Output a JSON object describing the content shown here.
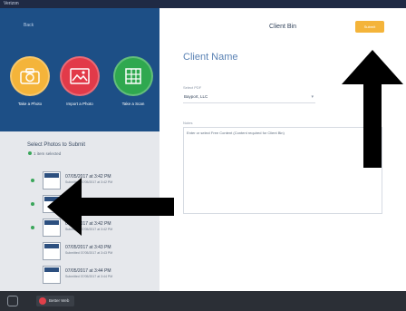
{
  "status_bar": {
    "left": "Verizon",
    "center": "",
    "right": ""
  },
  "sidebar": {
    "back_label": "Back",
    "actions": [
      {
        "label": "Take a Photo",
        "color": "#f4b43a",
        "icon": "camera-icon"
      },
      {
        "label": "Import a Photo",
        "color": "#e23a49",
        "icon": "image-icon"
      },
      {
        "label": "Take a Scan",
        "color": "#2fa84f",
        "icon": "scan-icon"
      }
    ],
    "photos_to_submit": {
      "title": "Select Photos to Submit",
      "subtitle": "1 item selected"
    },
    "photos": [
      {
        "timestamp": "07/05/2017 at 3:42 PM",
        "sub": "Submitted 07/05/2017 at 3:42 PM",
        "selected": true
      },
      {
        "timestamp": "",
        "sub": "",
        "selected": true
      },
      {
        "timestamp": "07/05/2017 at 3:42 PM",
        "sub": "Submitted 07/05/2017 at 3:42 PM",
        "selected": true
      },
      {
        "timestamp": "07/05/2017 at 3:43 PM",
        "sub": "Submitted 07/05/2017 at 3:43 PM",
        "selected": false
      },
      {
        "timestamp": "07/05/2017 at 3:44 PM",
        "sub": "Submitted 07/05/2017 at 3:44 PM",
        "selected": false
      }
    ]
  },
  "main": {
    "nav_title": "Client Bin",
    "submit_label": "Submit",
    "client_name": "Client Name",
    "select_label": "Select PDF",
    "select_value": "Bayport, LLC",
    "notes_label": "Notes",
    "notes_value": "Enter or select Free Content (Content required for Client Bin)"
  },
  "bottom_bar": {
    "badge_label": "Better Web"
  },
  "colors": {
    "sidebar_top": "#1d4f86",
    "accent": "#f4b43a",
    "status_bar": "#1f2a44"
  }
}
